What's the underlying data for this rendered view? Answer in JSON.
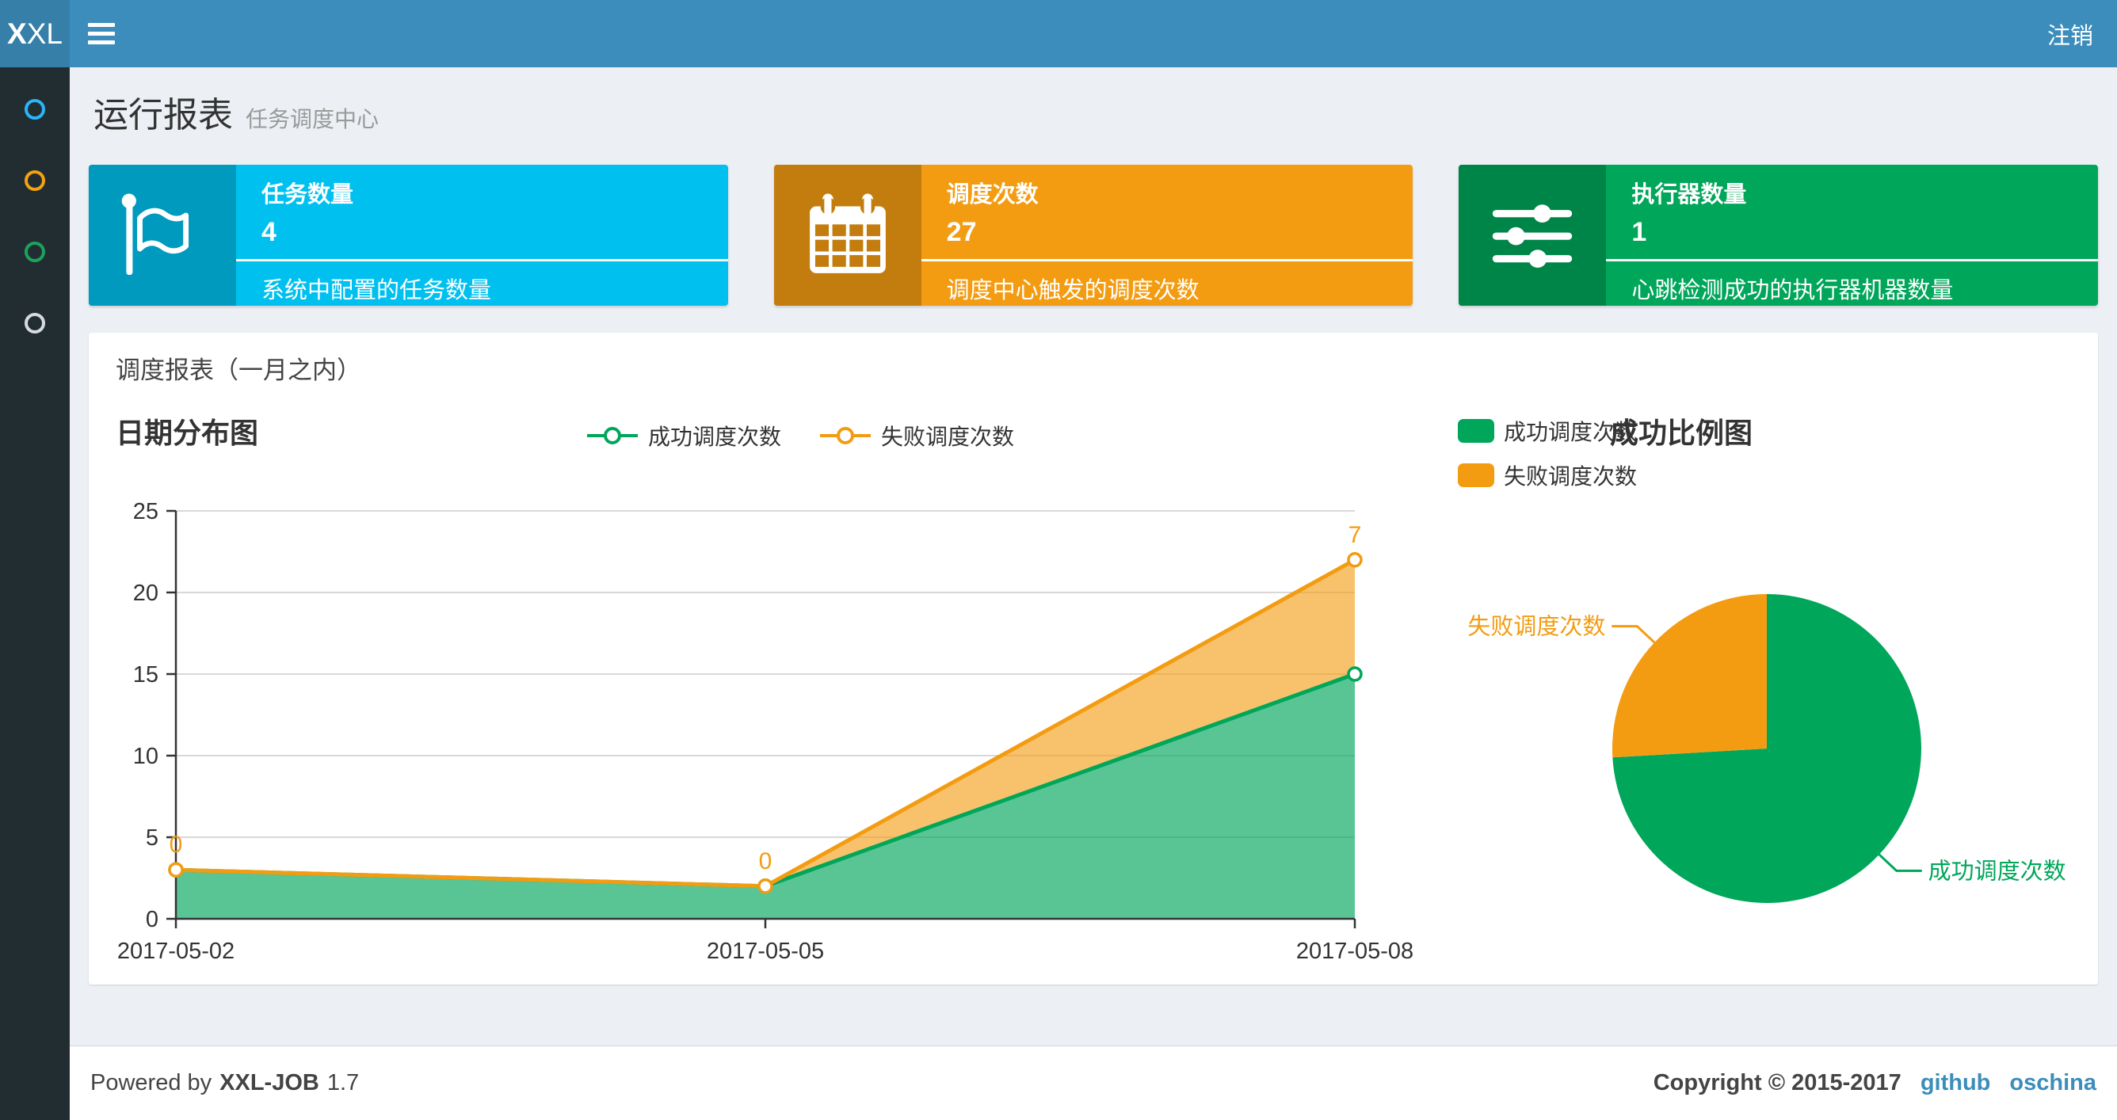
{
  "navbar": {
    "logo_bold": "X",
    "logo_light": "XL",
    "logout_label": "注销"
  },
  "sidebar": {
    "items": [
      {
        "name": "menu-item-1",
        "color": "#29b6f6"
      },
      {
        "name": "menu-item-2",
        "color": "#f3a30d"
      },
      {
        "name": "menu-item-3",
        "color": "#19a35c"
      },
      {
        "name": "menu-item-4",
        "color": "#d7dbdf"
      }
    ]
  },
  "header": {
    "title": "运行报表",
    "subtitle": "任务调度中心"
  },
  "info_boxes": [
    {
      "icon": "flag-icon",
      "label": "任务数量",
      "value": "4",
      "desc": "系统中配置的任务数量",
      "color": "#00c0ef",
      "color_dark": "#009abf"
    },
    {
      "icon": "calendar-icon",
      "label": "调度次数",
      "value": "27",
      "desc": "调度中心触发的调度次数",
      "color": "#f39c12",
      "color_dark": "#c27d0e"
    },
    {
      "icon": "sliders-icon",
      "label": "执行器数量",
      "value": "1",
      "desc": "心跳检测成功的执行器机器数量",
      "color": "#00a65a",
      "color_dark": "#008548"
    }
  ],
  "panel": {
    "title": "调度报表（一月之内）"
  },
  "chart_data": [
    {
      "type": "area",
      "title": "日期分布图",
      "categories": [
        "2017-05-02",
        "2017-05-05",
        "2017-05-08"
      ],
      "series": [
        {
          "name": "成功调度次数",
          "color": "#00a65a",
          "fill": "rgba(0,166,90,0.65)",
          "values": [
            3,
            2,
            15
          ]
        },
        {
          "name": "失败调度次数",
          "color": "#f39c12",
          "fill": "rgba(243,156,18,0.62)",
          "values": [
            0,
            0,
            7
          ],
          "point_labels": [
            "0",
            "0",
            "7"
          ]
        }
      ],
      "stacked": true,
      "grid": true,
      "legend_position": "top-center",
      "ylim": [
        0,
        25
      ],
      "yticks": [
        0,
        5,
        10,
        15,
        20,
        25
      ]
    },
    {
      "type": "pie",
      "title": "成功比例图",
      "slices": [
        {
          "name": "成功调度次数",
          "value": 20,
          "color": "#00a65a"
        },
        {
          "name": "失败调度次数",
          "value": 7,
          "color": "#f39c12"
        }
      ],
      "legend_position": "top-left"
    }
  ],
  "footer": {
    "powered_prefix": "Powered by",
    "product": "XXL-JOB",
    "version": "1.7",
    "copyright": "Copyright © 2015-2017",
    "links": [
      {
        "label": "github"
      },
      {
        "label": "oschina"
      }
    ]
  }
}
